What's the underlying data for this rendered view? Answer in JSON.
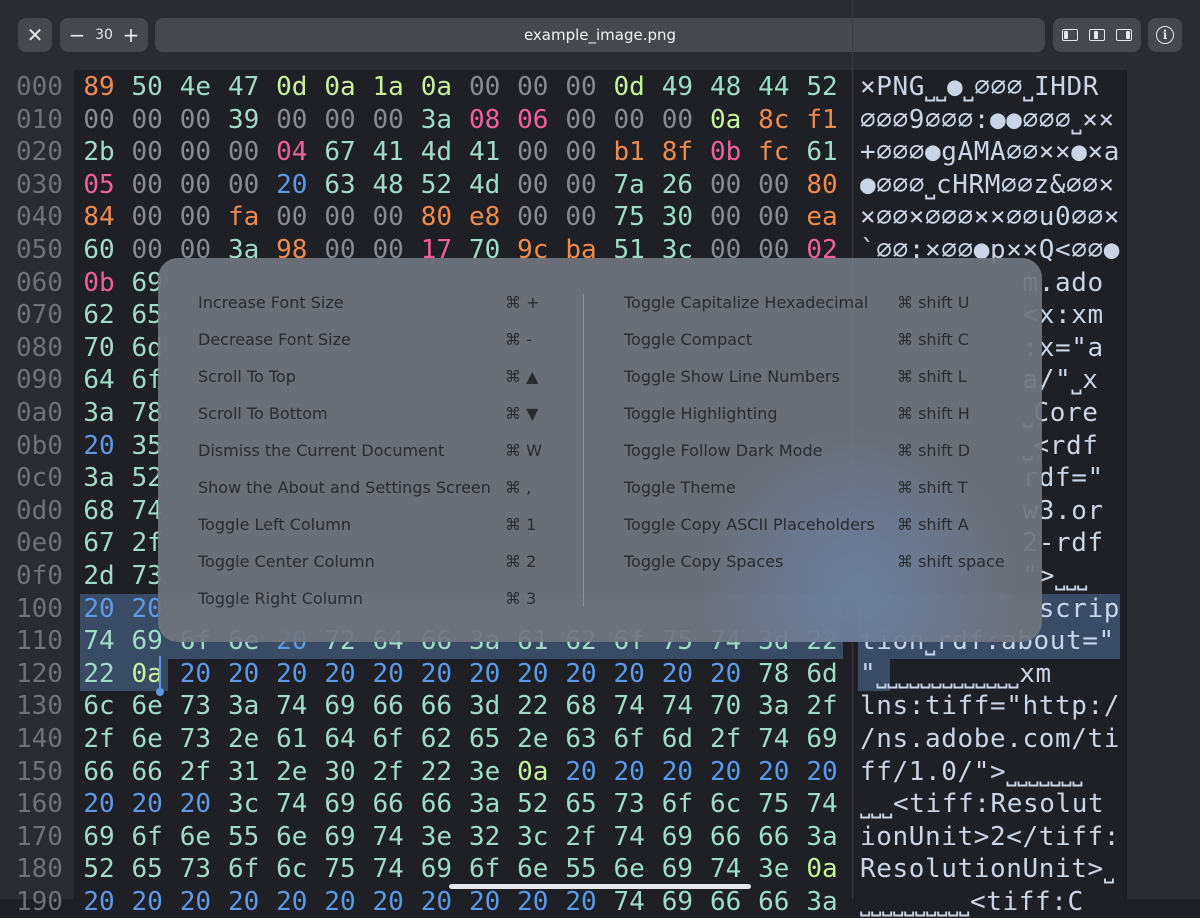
{
  "toolbar": {
    "font_size": "30",
    "decrease_symbol": "−",
    "increase_symbol": "+",
    "title": "example_image.png",
    "close_symbol": "✕",
    "info_symbol": "i",
    "icons": [
      "close-icon",
      "minus-icon",
      "plus-icon",
      "left-column-icon",
      "center-column-icon",
      "right-column-icon",
      "info-icon"
    ]
  },
  "hex": {
    "rows": [
      {
        "offset": "000",
        "bytes": [
          "89",
          "50",
          "4e",
          "47",
          "0d",
          "0a",
          "1a",
          "0a",
          "00",
          "00",
          "00",
          "0d",
          "49",
          "48",
          "44",
          "52"
        ],
        "ascii": "×PNG⎵⎵●⎵∅∅∅⎵IHDR"
      },
      {
        "offset": "010",
        "bytes": [
          "00",
          "00",
          "00",
          "39",
          "00",
          "00",
          "00",
          "3a",
          "08",
          "06",
          "00",
          "00",
          "00",
          "0a",
          "8c",
          "f1"
        ],
        "ascii": "∅∅∅9∅∅∅:●●∅∅∅⎵××"
      },
      {
        "offset": "020",
        "bytes": [
          "2b",
          "00",
          "00",
          "00",
          "04",
          "67",
          "41",
          "4d",
          "41",
          "00",
          "00",
          "b1",
          "8f",
          "0b",
          "fc",
          "61"
        ],
        "ascii": "+∅∅∅●gAMA∅∅××●×a"
      },
      {
        "offset": "030",
        "bytes": [
          "05",
          "00",
          "00",
          "00",
          "20",
          "63",
          "48",
          "52",
          "4d",
          "00",
          "00",
          "7a",
          "26",
          "00",
          "00",
          "80"
        ],
        "ascii": "●∅∅∅⎵cHRM∅∅z&∅∅×"
      },
      {
        "offset": "040",
        "bytes": [
          "84",
          "00",
          "00",
          "fa",
          "00",
          "00",
          "00",
          "80",
          "e8",
          "00",
          "00",
          "75",
          "30",
          "00",
          "00",
          "ea"
        ],
        "ascii": "×∅∅×∅∅∅××∅∅u0∅∅×"
      },
      {
        "offset": "050",
        "bytes": [
          "60",
          "00",
          "00",
          "3a",
          "98",
          "00",
          "00",
          "17",
          "70",
          "9c",
          "ba",
          "51",
          "3c",
          "00",
          "00",
          "02"
        ],
        "ascii": "`∅∅:×∅∅●p××Q<∅∅●"
      },
      {
        "offset": "060",
        "bytes": [
          "0b",
          "69",
          "",
          "",
          "",
          "",
          "",
          "",
          "",
          "",
          "",
          "",
          "",
          "",
          "",
          ""
        ],
        "ascii": "          m.ado"
      },
      {
        "offset": "070",
        "bytes": [
          "62",
          "65",
          "",
          "",
          "",
          "",
          "",
          "",
          "",
          "",
          "",
          "",
          "",
          "",
          "",
          ""
        ],
        "ascii": "          <x:xm"
      },
      {
        "offset": "080",
        "bytes": [
          "70",
          "6d",
          "",
          "",
          "",
          "",
          "",
          "",
          "",
          "",
          "",
          "",
          "",
          "",
          "",
          ""
        ],
        "ascii": "          :x=\"a"
      },
      {
        "offset": "090",
        "bytes": [
          "64",
          "6f",
          "",
          "",
          "",
          "",
          "",
          "",
          "",
          "",
          "",
          "",
          "",
          "",
          "",
          ""
        ],
        "ascii": "          a/\"⎵x"
      },
      {
        "offset": "0a0",
        "bytes": [
          "3a",
          "78",
          "",
          "",
          "",
          "",
          "",
          "",
          "",
          "",
          "",
          "",
          "",
          "",
          "",
          ""
        ],
        "ascii": "          ⎵Core"
      },
      {
        "offset": "0b0",
        "bytes": [
          "20",
          "35",
          "",
          "",
          "",
          "",
          "",
          "",
          "",
          "",
          "",
          "",
          "",
          "",
          "",
          ""
        ],
        "ascii": "          ⎵<rdf"
      },
      {
        "offset": "0c0",
        "bytes": [
          "3a",
          "52",
          "",
          "",
          "",
          "",
          "",
          "",
          "",
          "",
          "",
          "",
          "",
          "",
          "",
          ""
        ],
        "ascii": "          rdf=\""
      },
      {
        "offset": "0d0",
        "bytes": [
          "68",
          "74",
          "",
          "",
          "",
          "",
          "",
          "",
          "",
          "",
          "",
          "",
          "",
          "",
          "",
          ""
        ],
        "ascii": "          w3.or"
      },
      {
        "offset": "0e0",
        "bytes": [
          "67",
          "2f",
          "",
          "",
          "",
          "",
          "",
          "",
          "",
          "",
          "",
          "",
          "",
          "",
          "",
          ""
        ],
        "ascii": "          2-rdf"
      },
      {
        "offset": "0f0",
        "bytes": [
          "2d",
          "73",
          "",
          "",
          "",
          "",
          "",
          "",
          "",
          "",
          "",
          "",
          "",
          "",
          "",
          ""
        ],
        "ascii": "          \">⎵⎵⎵"
      },
      {
        "offset": "100",
        "bytes": [
          "20",
          "20",
          "",
          "",
          "",
          "",
          "",
          "",
          "",
          "",
          "",
          "",
          "",
          "",
          "",
          ""
        ],
        "ascii": "           scrip"
      },
      {
        "offset": "110",
        "bytes": [
          "74",
          "69",
          "6f",
          "6e",
          "20",
          "72",
          "64",
          "66",
          "3a",
          "61",
          "62",
          "6f",
          "75",
          "74",
          "3d",
          "22"
        ],
        "ascii": "tion⎵rdf:about=\""
      },
      {
        "offset": "120",
        "bytes": [
          "22",
          "0a",
          "20",
          "20",
          "20",
          "20",
          "20",
          "20",
          "20",
          "20",
          "20",
          "20",
          "20",
          "20",
          "78",
          "6d"
        ],
        "ascii": "\"⎵⎵⎵⎵⎵⎵⎵⎵⎵⎵⎵⎵⎵xm"
      },
      {
        "offset": "130",
        "bytes": [
          "6c",
          "6e",
          "73",
          "3a",
          "74",
          "69",
          "66",
          "66",
          "3d",
          "22",
          "68",
          "74",
          "74",
          "70",
          "3a",
          "2f"
        ],
        "ascii": "lns:tiff=\"http:/"
      },
      {
        "offset": "140",
        "bytes": [
          "2f",
          "6e",
          "73",
          "2e",
          "61",
          "64",
          "6f",
          "62",
          "65",
          "2e",
          "63",
          "6f",
          "6d",
          "2f",
          "74",
          "69"
        ],
        "ascii": "/ns.adobe.com/ti"
      },
      {
        "offset": "150",
        "bytes": [
          "66",
          "66",
          "2f",
          "31",
          "2e",
          "30",
          "2f",
          "22",
          "3e",
          "0a",
          "20",
          "20",
          "20",
          "20",
          "20",
          "20"
        ],
        "ascii": "ff/1.0/\">⎵⎵⎵⎵⎵⎵⎵"
      },
      {
        "offset": "160",
        "bytes": [
          "20",
          "20",
          "20",
          "3c",
          "74",
          "69",
          "66",
          "66",
          "3a",
          "52",
          "65",
          "73",
          "6f",
          "6c",
          "75",
          "74"
        ],
        "ascii": "⎵⎵⎵<tiff:Resolut"
      },
      {
        "offset": "170",
        "bytes": [
          "69",
          "6f",
          "6e",
          "55",
          "6e",
          "69",
          "74",
          "3e",
          "32",
          "3c",
          "2f",
          "74",
          "69",
          "66",
          "66",
          "3a"
        ],
        "ascii": "ionUnit>2</tiff:"
      },
      {
        "offset": "180",
        "bytes": [
          "52",
          "65",
          "73",
          "6f",
          "6c",
          "75",
          "74",
          "69",
          "6f",
          "6e",
          "55",
          "6e",
          "69",
          "74",
          "3e",
          "0a"
        ],
        "ascii": "ResolutionUnit>⎵"
      },
      {
        "offset": "190",
        "bytes": [
          "20",
          "20",
          "20",
          "20",
          "20",
          "20",
          "20",
          "20",
          "20",
          "20",
          "20",
          "74",
          "69",
          "66",
          "66",
          "3a"
        ],
        "ascii": "⎵⎵⎵⎵⎵⎵⎵⎵⎵⎵<tiff:C"
      }
    ]
  },
  "shortcuts": {
    "left": [
      {
        "label": "Increase Font Size",
        "key": "⌘ +"
      },
      {
        "label": "Decrease Font Size",
        "key": "⌘ -"
      },
      {
        "label": "Scroll To Top",
        "key": "⌘ ▲"
      },
      {
        "label": "Scroll To Bottom",
        "key": "⌘ ▼"
      },
      {
        "label": "Dismiss the Current Document",
        "key": "⌘ W"
      },
      {
        "label": "Show the About and Settings Screen",
        "key": "⌘ ,"
      },
      {
        "label": "Toggle Left Column",
        "key": "⌘ 1"
      },
      {
        "label": "Toggle Center Column",
        "key": "⌘ 2"
      },
      {
        "label": "Toggle Right Column",
        "key": "⌘ 3"
      }
    ],
    "right": [
      {
        "label": "Toggle Capitalize Hexadecimal",
        "key": "⌘ shift U"
      },
      {
        "label": "Toggle Compact",
        "key": "⌘ shift C"
      },
      {
        "label": "Toggle Show Line Numbers",
        "key": "⌘ shift L"
      },
      {
        "label": "Toggle Highlighting",
        "key": "⌘ shift H"
      },
      {
        "label": "Toggle Follow Dark Mode",
        "key": "⌘ shift D"
      },
      {
        "label": "Toggle Theme",
        "key": "⌘ shift T"
      },
      {
        "label": "Toggle Copy ASCII Placeholders",
        "key": "⌘ shift A"
      },
      {
        "label": "Toggle Copy Spaces",
        "key": "⌘ shift space"
      }
    ]
  },
  "colors": {
    "background": "#1e2026",
    "selection": "#3a4b66",
    "overlay": "#70757e"
  }
}
